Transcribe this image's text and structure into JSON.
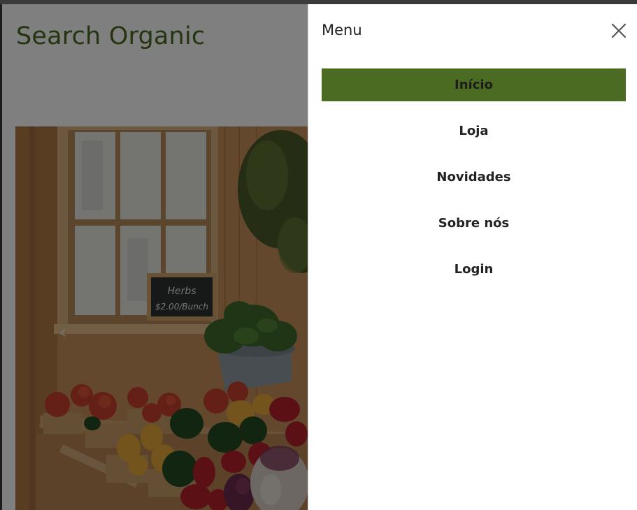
{
  "site": {
    "title": "Search Organic"
  },
  "hero": {
    "image": "farm-stand-vegetables-photo",
    "sign_text": "Herbs $2.00/Bunch",
    "prev_arrow": "‹"
  },
  "drawer": {
    "title": "Menu",
    "close_icon": "close-icon",
    "items": [
      {
        "label": "Início",
        "active": true
      },
      {
        "label": "Loja",
        "active": false
      },
      {
        "label": "Novidades",
        "active": false
      },
      {
        "label": "Sobre nós",
        "active": false
      },
      {
        "label": "Login",
        "active": false
      }
    ]
  },
  "colors": {
    "brand_green": "#4a6b21",
    "overlay": "rgba(0,0,0,0.5)",
    "text_dark": "#222222"
  }
}
